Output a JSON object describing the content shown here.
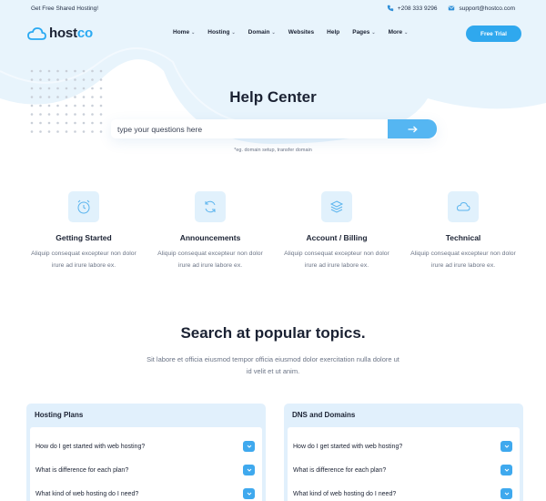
{
  "topbar": {
    "promo": "Get Free Shared Hosting!",
    "phone": "+208 333 9296",
    "email": "support@hostco.com"
  },
  "brand": {
    "name_part1": "host",
    "name_part2": "co"
  },
  "nav": {
    "items": [
      {
        "label": "Home",
        "dropdown": true
      },
      {
        "label": "Hosting",
        "dropdown": true
      },
      {
        "label": "Domain",
        "dropdown": true
      },
      {
        "label": "Websites",
        "dropdown": false
      },
      {
        "label": "Help",
        "dropdown": false
      },
      {
        "label": "Pages",
        "dropdown": true
      },
      {
        "label": "More",
        "dropdown": true
      }
    ],
    "cta": "Free Trial"
  },
  "hero": {
    "title": "Help Center",
    "search_placeholder": "type your questions here",
    "hint": "*eg. domain setup, transfer domain"
  },
  "categories": [
    {
      "title": "Getting Started",
      "icon": "alarm-clock-icon",
      "desc": "Aliquip consequat excepteur non dolor irure ad irure labore ex."
    },
    {
      "title": "Announcements",
      "icon": "refresh-icon",
      "desc": "Aliquip consequat excepteur non dolor irure ad irure labore ex."
    },
    {
      "title": "Account / Billing",
      "icon": "layers-icon",
      "desc": "Aliquip consequat excepteur non dolor irure ad irure labore ex."
    },
    {
      "title": "Technical",
      "icon": "cloud-icon",
      "desc": "Aliquip consequat excepteur non dolor irure ad irure labore ex."
    }
  ],
  "popular": {
    "title": "Search at popular topics.",
    "desc": "Sit labore et officia eiusmod tempor officia eiusmod dolor exercitation nulla dolore ut id velit et ut anim."
  },
  "panels": [
    {
      "title": "Hosting Plans",
      "questions": [
        "How do I get started with web hosting?",
        "What is difference for each plan?",
        "What kind of web hosting do I need?"
      ]
    },
    {
      "title": "DNS and Domains",
      "questions": [
        "How do I get started with web hosting?",
        "What is difference for each plan?",
        "What kind of web hosting do I need?"
      ]
    }
  ],
  "colors": {
    "accent": "#2fa8ee",
    "light": "#e1f0fc",
    "text": "#1b2233",
    "muted": "#6b7486"
  }
}
